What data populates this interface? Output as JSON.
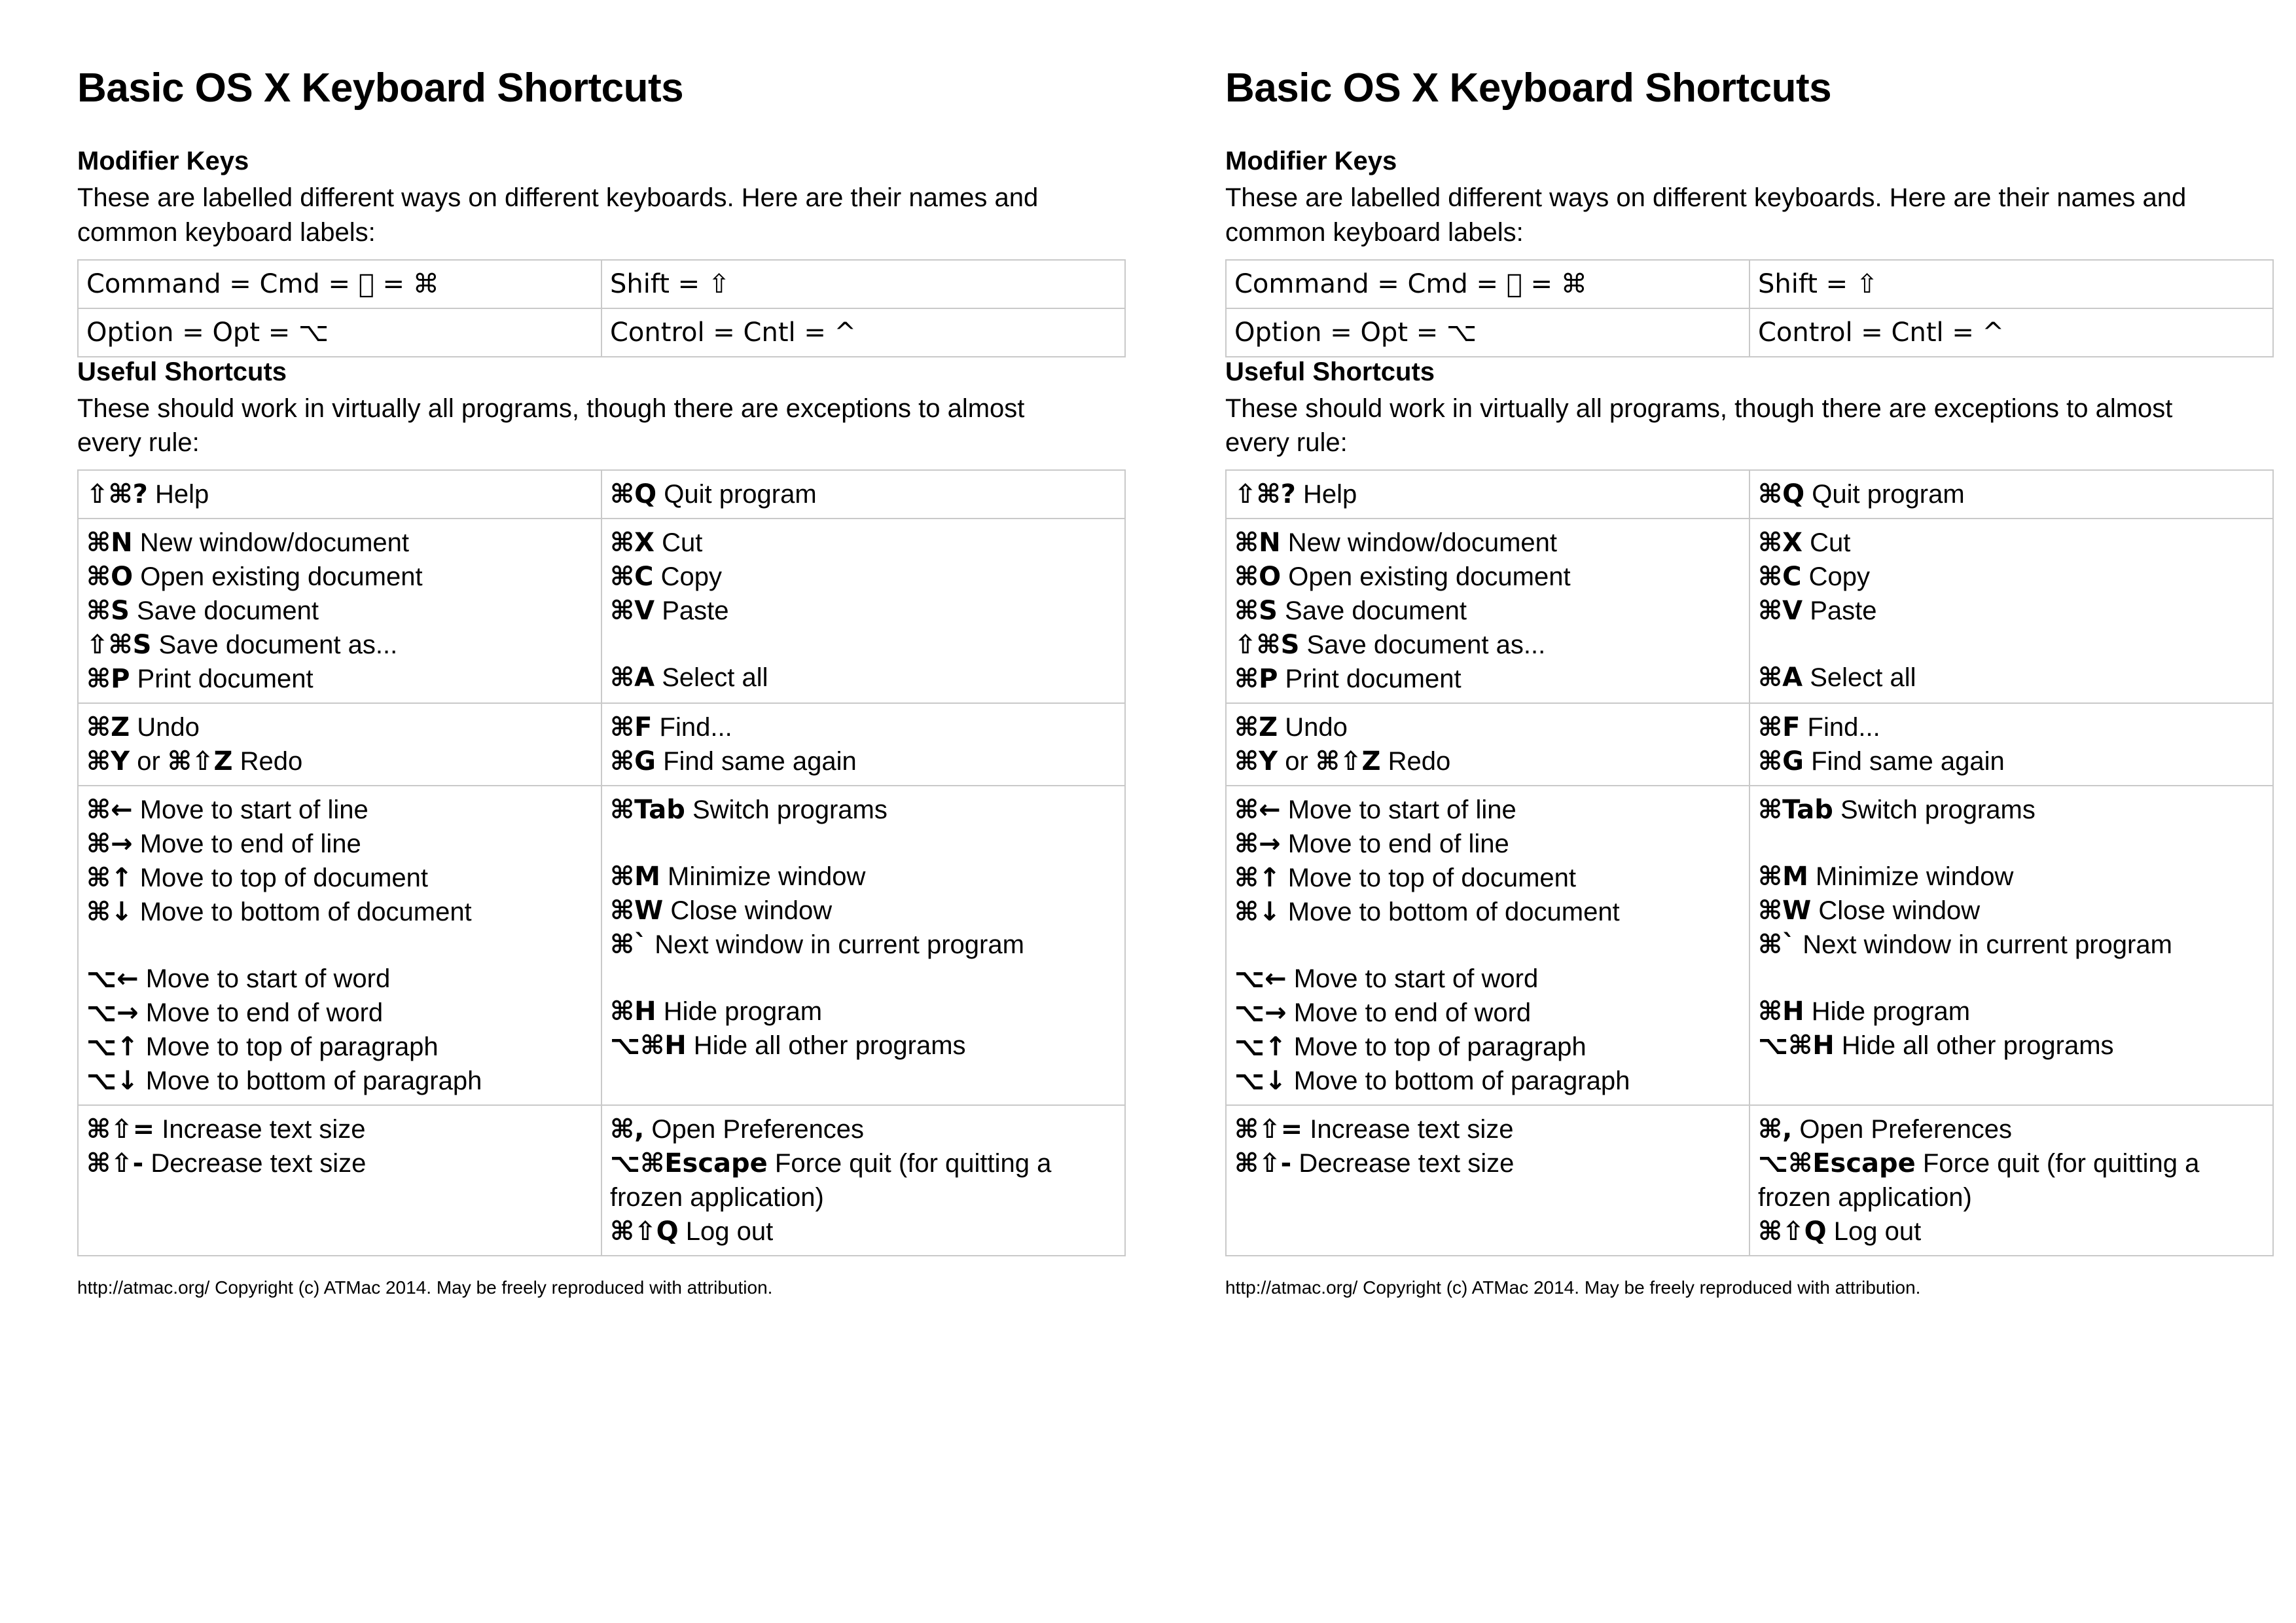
{
  "document": {
    "title": "Basic OS X Keyboard Shortcuts",
    "footer": "http://atmac.org/ Copyright (c) ATMac 2014. May be freely reproduced with attribution."
  },
  "modifier_section": {
    "heading": "Modifier Keys",
    "intro": "These are labelled different ways on different keyboards. Here are their names and common keyboard labels:",
    "rows": [
      {
        "left": "Command = Cmd =  = ⌘",
        "right": "Shift = ⇧"
      },
      {
        "left": "Option = Opt = ⌥",
        "right": "Control = Cntl = ^"
      }
    ]
  },
  "shortcuts_section": {
    "heading": "Useful Shortcuts",
    "intro": "These should work in virtually all programs, though there are exceptions to almost every rule:",
    "rows": [
      {
        "left": [
          {
            "keys": "⇧⌘?",
            "desc": " Help"
          }
        ],
        "right": [
          {
            "keys": "⌘Q",
            "desc": " Quit program"
          }
        ]
      },
      {
        "left": [
          {
            "keys": "⌘N",
            "desc": " New window/document"
          },
          {
            "keys": "⌘O",
            "desc": " Open existing document"
          },
          {
            "keys": "⌘S",
            "desc": " Save document"
          },
          {
            "keys": "⇧⌘S",
            "desc": " Save document as..."
          },
          {
            "keys": "⌘P",
            "desc": " Print document"
          }
        ],
        "right": [
          {
            "keys": "⌘X",
            "desc": " Cut"
          },
          {
            "keys": "⌘C",
            "desc": " Copy"
          },
          {
            "keys": "⌘V",
            "desc": " Paste"
          },
          {
            "keys": "",
            "desc": "",
            "blank": true
          },
          {
            "keys": "⌘A",
            "desc": " Select all"
          }
        ]
      },
      {
        "left": [
          {
            "keys": "⌘Z",
            "desc": " Undo"
          },
          {
            "keys": "⌘Y",
            "desc": " or ",
            "keys2": "⌘⇧Z",
            "desc2": " Redo"
          }
        ],
        "right": [
          {
            "keys": "⌘F",
            "desc": " Find..."
          },
          {
            "keys": "⌘G",
            "desc": " Find same again"
          }
        ]
      },
      {
        "left": [
          {
            "keys": "⌘←",
            "desc": " Move to start of line"
          },
          {
            "keys": "⌘→",
            "desc": " Move to end of line"
          },
          {
            "keys": "⌘↑",
            "desc": " Move to top of document"
          },
          {
            "keys": "⌘↓",
            "desc": " Move to bottom of document"
          },
          {
            "keys": "",
            "desc": "",
            "blank": true
          },
          {
            "keys": "⌥←",
            "desc": " Move to start of word"
          },
          {
            "keys": "⌥→",
            "desc": " Move to end of word"
          },
          {
            "keys": "⌥↑",
            "desc": " Move to top of paragraph"
          },
          {
            "keys": "⌥↓",
            "desc": " Move to bottom of paragraph"
          }
        ],
        "right": [
          {
            "keys": "⌘Tab",
            "desc": " Switch programs"
          },
          {
            "keys": "",
            "desc": "",
            "blank": true
          },
          {
            "keys": "⌘M",
            "desc": " Minimize window"
          },
          {
            "keys": "⌘W",
            "desc": " Close window"
          },
          {
            "keys": "⌘`",
            "desc": " Next window in current program"
          },
          {
            "keys": "",
            "desc": "",
            "blank": true
          },
          {
            "keys": "⌘H",
            "desc": " Hide program"
          },
          {
            "keys": "⌥⌘H",
            "desc": " Hide all other programs"
          }
        ]
      },
      {
        "left": [
          {
            "keys": "⌘⇧=",
            "desc": " Increase text size"
          },
          {
            "keys": "⌘⇧-",
            "desc": " Decrease text size"
          }
        ],
        "right": [
          {
            "keys": "⌘,",
            "desc": " Open Preferences"
          },
          {
            "keys": "⌥⌘Escape",
            "desc": " Force quit (for quitting a frozen application)"
          },
          {
            "keys": "⌘⇧Q",
            "desc": " Log out"
          }
        ]
      }
    ]
  }
}
